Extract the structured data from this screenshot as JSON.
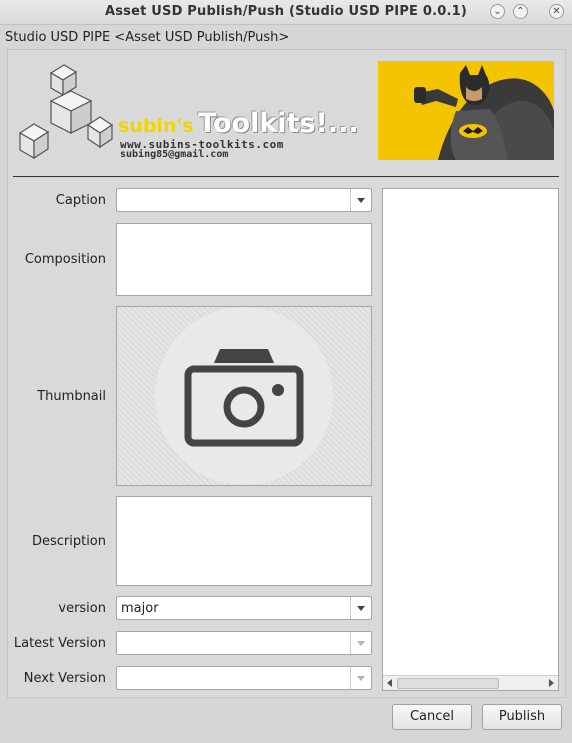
{
  "window": {
    "title": "Asset USD Publish/Push (Studio USD PIPE 0.0.1)",
    "controls": [
      "minimize-icon",
      "maximize-icon",
      "close-icon"
    ]
  },
  "breadcrumb": "Studio USD PIPE <Asset USD Publish/Push>",
  "branding": {
    "name_part1": "subin's",
    "name_part2": "Toolkits!...",
    "url": "www.subins-toolkits.com",
    "email": "subing85@gmail.com",
    "hero_image": "caped-hero-banner"
  },
  "form": {
    "caption": {
      "label": "Caption",
      "value": ""
    },
    "composition": {
      "label": "Composition",
      "value": ""
    },
    "thumbnail": {
      "label": "Thumbnail",
      "icon": "camera-icon"
    },
    "description": {
      "label": "Description",
      "value": ""
    },
    "version": {
      "label": "version",
      "value": "major"
    },
    "latest_version": {
      "label": "Latest Version",
      "value": ""
    },
    "next_version": {
      "label": "Next Version",
      "value": ""
    }
  },
  "buttons": {
    "cancel": "Cancel",
    "publish": "Publish"
  },
  "colors": {
    "accent_yellow": "#f5c400",
    "background": "#d6d6d6"
  }
}
